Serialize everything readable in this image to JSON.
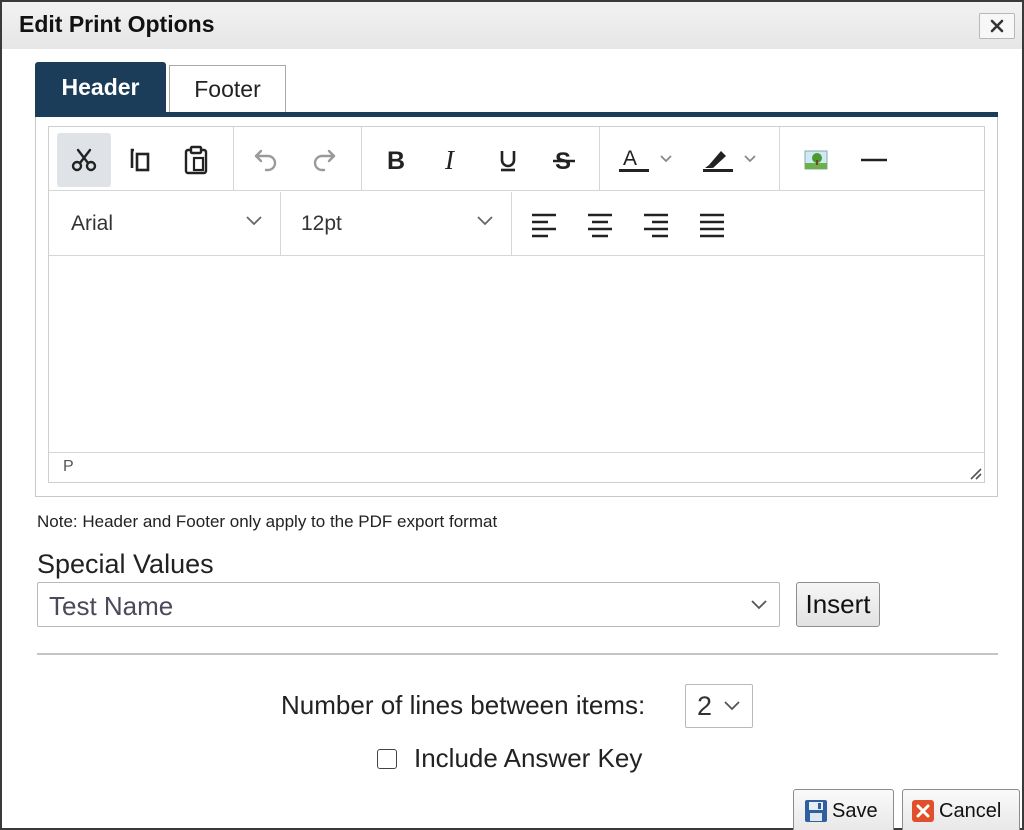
{
  "dialog": {
    "title": "Edit Print Options",
    "close_icon": "close-icon"
  },
  "tabs": [
    {
      "label": "Header",
      "active": true
    },
    {
      "label": "Footer",
      "active": false
    }
  ],
  "editor": {
    "toolbar": {
      "clipboard": [
        "cut-icon",
        "copy-icon",
        "paste-icon"
      ],
      "history": [
        "undo-icon",
        "redo-icon"
      ],
      "format": [
        "bold-icon",
        "italic-icon",
        "underline-icon",
        "strikethrough-icon"
      ],
      "color": [
        "text-color-icon",
        "highlight-color-icon"
      ],
      "insert": [
        "image-icon",
        "horizontal-rule-icon"
      ],
      "align": [
        "align-left-icon",
        "align-center-icon",
        "align-right-icon",
        "align-justify-icon"
      ]
    },
    "font_family": "Arial",
    "font_size": "12pt",
    "status_path": "P",
    "content": ""
  },
  "note": "Note: Header and Footer only apply to the PDF export format",
  "special_values": {
    "label": "Special Values",
    "selected": "Test Name",
    "insert_label": "Insert"
  },
  "lines_between": {
    "label": "Number of lines between items:",
    "value": "2"
  },
  "answer_key": {
    "label": "Include Answer Key",
    "checked": false
  },
  "buttons": {
    "save": "Save",
    "cancel": "Cancel"
  },
  "colors": {
    "tab_active": "#1c3d5a",
    "save_icon": "#2f5f9e",
    "cancel_icon": "#e0502a",
    "image_icon": "#4a9a2e"
  }
}
